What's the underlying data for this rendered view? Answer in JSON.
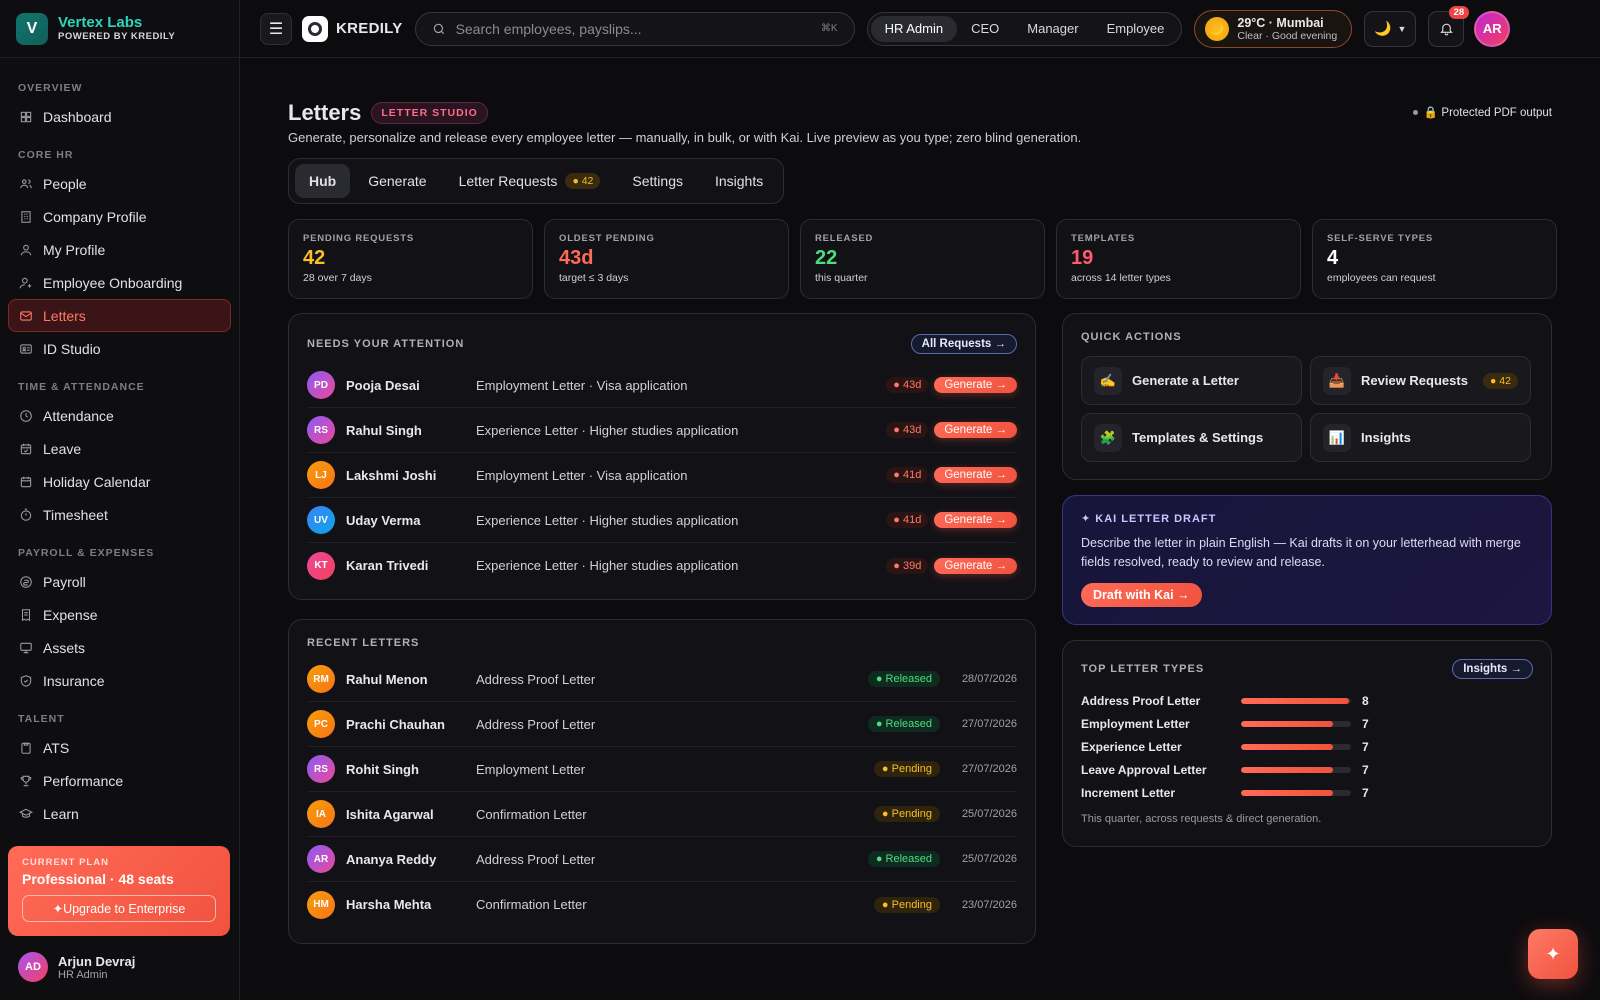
{
  "brand": {
    "name": "Vertex Labs",
    "logo_letter": "V",
    "sub": "POWERED BY KREDILY"
  },
  "sidebar": {
    "sections": [
      {
        "title": "OVERVIEW",
        "items": [
          {
            "label": "Dashboard",
            "icon": "grid-icon"
          }
        ]
      },
      {
        "title": "CORE HR",
        "items": [
          {
            "label": "People",
            "icon": "users-icon"
          },
          {
            "label": "Company Profile",
            "icon": "building-icon"
          },
          {
            "label": "My Profile",
            "icon": "user-icon"
          },
          {
            "label": "Employee Onboarding",
            "icon": "user-plus-icon"
          },
          {
            "label": "Letters",
            "icon": "mail-icon",
            "active": true
          },
          {
            "label": "ID Studio",
            "icon": "id-card-icon"
          }
        ]
      },
      {
        "title": "TIME & ATTENDANCE",
        "items": [
          {
            "label": "Attendance",
            "icon": "clock-icon"
          },
          {
            "label": "Leave",
            "icon": "calendar-check-icon"
          },
          {
            "label": "Holiday Calendar",
            "icon": "calendar-icon"
          },
          {
            "label": "Timesheet",
            "icon": "stopwatch-icon"
          }
        ]
      },
      {
        "title": "PAYROLL & EXPENSES",
        "items": [
          {
            "label": "Payroll",
            "icon": "coin-icon"
          },
          {
            "label": "Expense",
            "icon": "receipt-icon"
          },
          {
            "label": "Assets",
            "icon": "monitor-icon"
          },
          {
            "label": "Insurance",
            "icon": "shield-icon"
          }
        ]
      },
      {
        "title": "TALENT",
        "items": [
          {
            "label": "ATS",
            "icon": "clipboard-icon"
          },
          {
            "label": "Performance",
            "icon": "trophy-icon"
          },
          {
            "label": "Learn",
            "icon": "graduation-icon"
          }
        ]
      }
    ],
    "plan": {
      "label": "CURRENT PLAN",
      "name": "Professional · 48 seats",
      "cta": "✦Upgrade to Enterprise"
    },
    "user": {
      "initials": "AD",
      "name": "Arjun Devraj",
      "role": "HR Admin"
    }
  },
  "topbar": {
    "product": "KREDILY",
    "search_placeholder": "Search employees, payslips...",
    "search_kbd": "⌘K",
    "roles": [
      "HR Admin",
      "CEO",
      "Manager",
      "Employee"
    ],
    "active_role": "HR Admin",
    "weather": {
      "temp_city": "29°C · Mumbai",
      "cond": "Clear · Good evening",
      "icon": "🌙"
    },
    "theme_icon": "🌙",
    "notifications": "28",
    "avatar": "AR"
  },
  "page": {
    "title": "Letters",
    "badge": "LETTER STUDIO",
    "protected": "🔒 Protected PDF output",
    "description": "Generate, personalize and release every employee letter — manually, in bulk, or with Kai. Live preview as you type; zero blind generation.",
    "tabs": [
      {
        "label": "Hub",
        "active": true
      },
      {
        "label": "Generate"
      },
      {
        "label": "Letter Requests",
        "badge": "● 42"
      },
      {
        "label": "Settings"
      },
      {
        "label": "Insights"
      }
    ]
  },
  "stats": [
    {
      "label": "PENDING REQUESTS",
      "value": "42",
      "sub": "28 over 7 days",
      "color": "#fbbf24"
    },
    {
      "label": "OLDEST PENDING",
      "value": "43d",
      "sub": "target ≤ 3 days",
      "color": "#ff6b57"
    },
    {
      "label": "RELEASED",
      "value": "22",
      "sub": "this quarter",
      "color": "#4ade80"
    },
    {
      "label": "TEMPLATES",
      "value": "19",
      "sub": "across 14 letter types",
      "color": "#ff5a6e"
    },
    {
      "label": "SELF-SERVE TYPES",
      "value": "4",
      "sub": "employees can request",
      "color": "#ffffff"
    }
  ],
  "attention": {
    "title": "NEEDS YOUR ATTENTION",
    "button": "All Requests →",
    "action_label": "Generate →",
    "rows": [
      {
        "initials": "PD",
        "name": "Pooja Desai",
        "type": "Employment Letter · Visa application",
        "age": "● 43d",
        "grad": "#8b5cf6,#ec4899"
      },
      {
        "initials": "RS",
        "name": "Rahul Singh",
        "type": "Experience Letter · Higher studies application",
        "age": "● 43d",
        "grad": "#8b5cf6,#ec4899"
      },
      {
        "initials": "LJ",
        "name": "Lakshmi Joshi",
        "type": "Employment Letter · Visa application",
        "age": "● 41d",
        "grad": "#f59e0b,#f97316"
      },
      {
        "initials": "UV",
        "name": "Uday Verma",
        "type": "Experience Letter · Higher studies application",
        "age": "● 41d",
        "grad": "#3b82f6,#0ea5e9"
      },
      {
        "initials": "KT",
        "name": "Karan Trivedi",
        "type": "Experience Letter · Higher studies application",
        "age": "● 39d",
        "grad": "#ec4899,#f43f5e"
      }
    ]
  },
  "recent": {
    "title": "RECENT LETTERS",
    "rows": [
      {
        "initials": "RM",
        "name": "Rahul Menon",
        "type": "Address Proof Letter",
        "status": "● Released",
        "kind": "rel",
        "date": "28/07/2026",
        "grad": "#f59e0b,#f97316"
      },
      {
        "initials": "PC",
        "name": "Prachi Chauhan",
        "type": "Address Proof Letter",
        "status": "● Released",
        "kind": "rel",
        "date": "27/07/2026",
        "grad": "#f59e0b,#f97316"
      },
      {
        "initials": "RS",
        "name": "Rohit Singh",
        "type": "Employment Letter",
        "status": "● Pending",
        "kind": "pen",
        "date": "27/07/2026",
        "grad": "#8b5cf6,#ec4899"
      },
      {
        "initials": "IA",
        "name": "Ishita Agarwal",
        "type": "Confirmation Letter",
        "status": "● Pending",
        "kind": "pen",
        "date": "25/07/2026",
        "grad": "#f59e0b,#f97316"
      },
      {
        "initials": "AR",
        "name": "Ananya Reddy",
        "type": "Address Proof Letter",
        "status": "● Released",
        "kind": "rel",
        "date": "25/07/2026",
        "grad": "#8b5cf6,#ec4899"
      },
      {
        "initials": "HM",
        "name": "Harsha Mehta",
        "type": "Confirmation Letter",
        "status": "● Pending",
        "kind": "pen",
        "date": "23/07/2026",
        "grad": "#f59e0b,#f97316"
      }
    ]
  },
  "quick": {
    "title": "QUICK ACTIONS",
    "items": [
      {
        "label": "Generate a Letter",
        "icon": "✍️"
      },
      {
        "label": "Review Requests",
        "icon": "📥",
        "badge": "● 42"
      },
      {
        "label": "Templates & Settings",
        "icon": "🧩"
      },
      {
        "label": "Insights",
        "icon": "📊"
      }
    ]
  },
  "kai": {
    "title": "✦ KAI LETTER DRAFT",
    "desc": "Describe the letter in plain English — Kai drafts it on your letterhead with merge fields resolved, ready to review and release.",
    "cta": "Draft with Kai →"
  },
  "top_types": {
    "title": "TOP LETTER TYPES",
    "button": "Insights →",
    "max": 8,
    "items": [
      {
        "label": "Address Proof Letter",
        "value": 8
      },
      {
        "label": "Employment Letter",
        "value": 7
      },
      {
        "label": "Experience Letter",
        "value": 7
      },
      {
        "label": "Leave Approval Letter",
        "value": 7
      },
      {
        "label": "Increment Letter",
        "value": 7
      }
    ],
    "note": "This quarter, across requests & direct generation."
  },
  "fab_icon": "✦"
}
